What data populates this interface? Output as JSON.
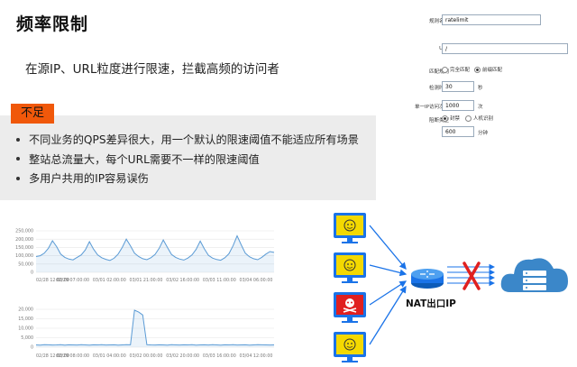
{
  "title": "频率限制",
  "subtitle": "在源IP、URL粒度进行限速，拦截高频的访问者",
  "shortcoming_tag": "不足",
  "bullets": [
    "不同业务的QPS差异很大，用一个默认的限速阈值不能适应所有场景",
    "整站总流量大，每个URL需要不一样的限速阈值",
    "多用户共用的IP容易误伤"
  ],
  "form": {
    "rule_name_label": "规则名称",
    "rule_name_value": "ratelimit",
    "url_label": "URL",
    "url_value": "/",
    "match_label": "匹配规则",
    "match_exact": "完全匹配",
    "match_prefix": "前缀匹配",
    "match_selected": "前缀匹配",
    "period_label": "检测时长",
    "period_value": "30",
    "period_unit": "秒",
    "count_label": "单一IP访问次数",
    "count_value": "1000",
    "count_unit": "次",
    "action_label": "阻断类型",
    "action_block": "封禁",
    "action_captcha": "人机识别",
    "action_selected": "封禁",
    "duration_value": "600",
    "duration_unit": "分钟"
  },
  "chart_data": [
    {
      "type": "line",
      "yticks": [
        "250,000",
        "200,000",
        "150,000",
        "100,000",
        "50,000",
        "0"
      ],
      "ylim": [
        0,
        250000
      ],
      "xticks": [
        "02/28 12:00:00",
        "02/29 07:00:00",
        "03/01 02:00:00",
        "03/01 21:00:00",
        "03/02 16:00:00",
        "03/03 11:00:00",
        "03/04 06:00:00"
      ],
      "series": [
        {
          "color": "#5b9bd5",
          "values": [
            95000,
            100000,
            115000,
            145000,
            190000,
            155000,
            110000,
            90000,
            80000,
            75000,
            90000,
            105000,
            135000,
            185000,
            140000,
            105000,
            88000,
            78000,
            72000,
            85000,
            110000,
            150000,
            200000,
            160000,
            115000,
            95000,
            82000,
            76000,
            88000,
            108000,
            145000,
            195000,
            150000,
            108000,
            90000,
            80000,
            74000,
            86000,
            105000,
            138000,
            188000,
            142000,
            102000,
            86000,
            77000,
            73000,
            88000,
            112000,
            160000,
            220000,
            165000,
            115000,
            94000,
            82000,
            76000,
            90000,
            110000,
            125000,
            120000
          ]
        }
      ]
    },
    {
      "type": "line",
      "yticks": [
        "20,000",
        "15,000",
        "10,000",
        "5,000",
        "0"
      ],
      "ylim": [
        0,
        20000
      ],
      "xticks": [
        "02/28 12:00:00",
        "02/29 08:00:00",
        "03/01 04:00:00",
        "03/02 00:00:00",
        "03/02 20:00:00",
        "03/03 16:00:00",
        "03/04 12:00:00"
      ],
      "series": [
        {
          "color": "#5b9bd5",
          "values": [
            1200,
            1100,
            1300,
            1250,
            1150,
            1200,
            1300,
            1100,
            1250,
            1200,
            1150,
            1300,
            1200,
            1100,
            1250,
            1200,
            1300,
            1150,
            1200,
            1250,
            1100,
            1200,
            1300,
            1250,
            19500,
            18500,
            17000,
            1300,
            1200,
            1150,
            1250,
            1200,
            1100,
            1300,
            1200,
            1150,
            1250,
            1200,
            1300,
            1100,
            1200,
            1250,
            1150,
            1300,
            1200,
            1100,
            1250,
            1200,
            1300,
            1150,
            1200,
            1250,
            1100,
            1200,
            1300,
            1250,
            1200,
            1150,
            1200
          ]
        }
      ]
    }
  ],
  "diagram": {
    "nat_label": "NAT出口IP",
    "colors": {
      "good": "#f4d900",
      "bad": "#e02020",
      "screen": "#1a73e8",
      "arrow": "#1a73e8",
      "cross": "#e02020",
      "cloud": "#3b87c9"
    }
  }
}
